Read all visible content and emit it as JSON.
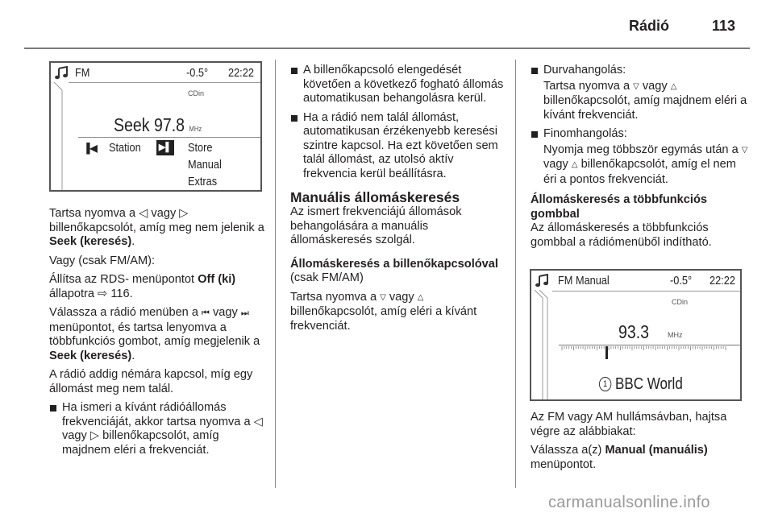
{
  "header": {
    "section_title": "Rádió",
    "page_number": "113"
  },
  "screen1": {
    "band": "FM",
    "temperature": "-0.5°",
    "clock": "22:22",
    "source_label": "CDin",
    "seek_label": "Seek 97.8",
    "unit": "MHz",
    "menu": {
      "prev_label": "Station",
      "items": [
        "Store",
        "Manual",
        "Extras"
      ]
    },
    "icons": [
      "music-note-icon",
      "skip-back-icon",
      "skip-forward-icon"
    ]
  },
  "screen2": {
    "title": "FM Manual",
    "temperature": "-0.5°",
    "clock": "22:22",
    "source_label": "CDin",
    "frequency": "93.3",
    "unit": "MHz",
    "preset_number": "1",
    "station_name": "BBC World",
    "icons": [
      "music-note-icon",
      "tuning-scale",
      "preset-circle-icon"
    ]
  },
  "col1": {
    "p1_a": "Tartsa nyomva a ",
    "p1_sym1": "◁",
    "p1_b": " vagy ",
    "p1_sym2": "▷",
    "p1_c": " billenőkapcsolót, amíg meg nem jelenik a ",
    "p1_bold": "Seek (keresés)",
    "p1_d": ".",
    "p2": "Vagy (csak FM/AM):",
    "p3_a": "Állítsa az RDS- menüpontot ",
    "p3_bold": "Off (ki)",
    "p3_b": " állapotra ",
    "p3_ref": "⇨ 116",
    "p3_c": ".",
    "p4_a": "Válassza a rádió menüben a ",
    "p4_sym1": "⏮",
    "p4_b": " vagy ",
    "p4_sym2": "⏭",
    "p4_c": " menüpontot, és tartsa lenyomva a többfunkciós gombot, amíg megjelenik a ",
    "p4_bold": "Seek (keresés)",
    "p4_d": ".",
    "p5": "A rádió addig némára kapcsol, míg egy állomást meg nem talál.",
    "bullet1_a": "Ha ismeri a kívánt rádióállomás frekvenciáját, akkor tartsa nyomva a ",
    "bullet1_sym1": "◁",
    "bullet1_b": " vagy ",
    "bullet1_sym2": "▷",
    "bullet1_c": " billenőkapcsolót, amíg majdnem eléri a frekvenciát."
  },
  "col2": {
    "bullet1": "A billenőkapcsoló elengedését követően a következő fogható állomás automatikusan behangolásra kerül.",
    "bullet2": "Ha a rádió nem talál állomást, automatikusan érzékenyebb keresési szintre kapcsol. Ha ezt követően sem talál állomást, az utolsó aktív frekvencia kerül beállításra.",
    "heading": "Manuális állomáskeresés",
    "intro": "Az ismert frekvenciájú állomások behangolására a manuális állomáskeresés szolgál.",
    "subheading": "Állomáskeresés a billenőkapcsolóval",
    "subheading_note": "(csak FM/AM)",
    "p_a": "Tartsa nyomva a ",
    "p_sym1": "▽",
    "p_b": " vagy ",
    "p_sym2": "△",
    "p_c": " billenőkapcsolót, amíg eléri a kívánt frekvenciát."
  },
  "col3": {
    "bullet1_title": "Durvahangolás:",
    "bullet1_a": "Tartsa nyomva a ",
    "bullet1_sym1": "▽",
    "bullet1_b": " vagy ",
    "bullet1_sym2": "△",
    "bullet1_c": " billenőkapcsolót, amíg majdnem eléri a kívánt frekvenciát.",
    "bullet2_title": "Finomhangolás:",
    "bullet2_a": "Nyomja meg többször egymás után a ",
    "bullet2_sym1": "▽",
    "bullet2_b": " vagy ",
    "bullet2_sym2": "△",
    "bullet2_c": " billenőkapcsolót, amíg el nem éri a pontos frekvenciát.",
    "subheading": "Állomáskeresés a többfunkciós gombbal",
    "intro": "Az állomáskeresés a többfunkciós gombbal a rádiómenüből indítható.",
    "p1": "Az FM vagy AM hullámsávban, hajtsa végre az alábbiakat:",
    "p2_a": "Válassza a(z) ",
    "p2_bold": "Manual (manuális)",
    "p2_b": " menüpontot."
  },
  "footer": {
    "watermark": "carmanualsonline.info"
  }
}
